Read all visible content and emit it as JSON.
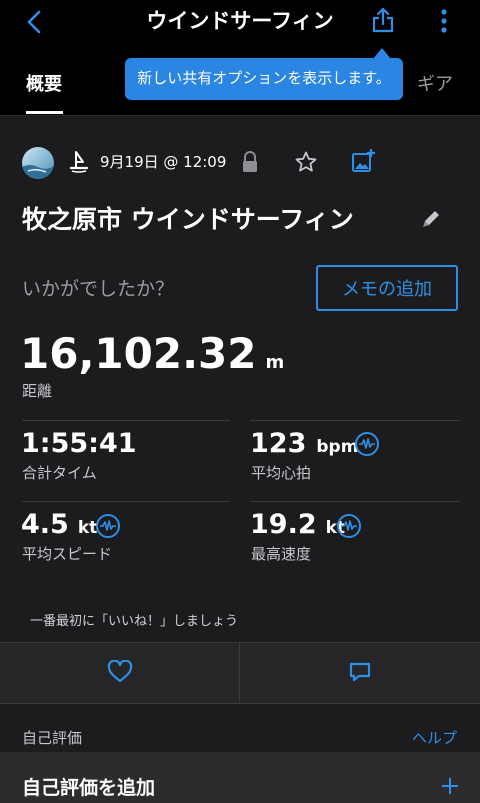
{
  "header": {
    "title": "ウインドサーフィン",
    "icons": [
      "back-icon",
      "share-icon",
      "more-icon"
    ]
  },
  "tabs": [
    {
      "label": "概要",
      "active": true
    },
    {
      "label": "ギア",
      "active": false
    }
  ],
  "tooltip": "新しい共有オプションを表示します。",
  "activity": {
    "date": "9月19日 @ 12:09",
    "name": "牧之原市 ウインドサーフィン",
    "how_was_it": "いかがでしたか？",
    "add_note": "メモの追加"
  },
  "distance": {
    "value": "16,102.32",
    "unit": "m",
    "label": "距離"
  },
  "metrics": [
    {
      "value": "1:55:41",
      "unit": "",
      "label": "合計タイム"
    },
    {
      "value": "123",
      "unit": "bpm",
      "label": "平均心拍"
    },
    {
      "value": "4.5",
      "unit": "kt",
      "label": "平均スピード"
    },
    {
      "value": "19.2",
      "unit": "kt",
      "label": "最高速度"
    }
  ],
  "like_prompt": "一番最初に「いいね！」しましょう",
  "self_eval": {
    "section_label": "自己評価",
    "help": "ヘルプ",
    "add_label": "自己評価を追加"
  },
  "colors": {
    "accent": "#2e8fe6",
    "background": "#1c1c1e",
    "header": "#000000"
  }
}
